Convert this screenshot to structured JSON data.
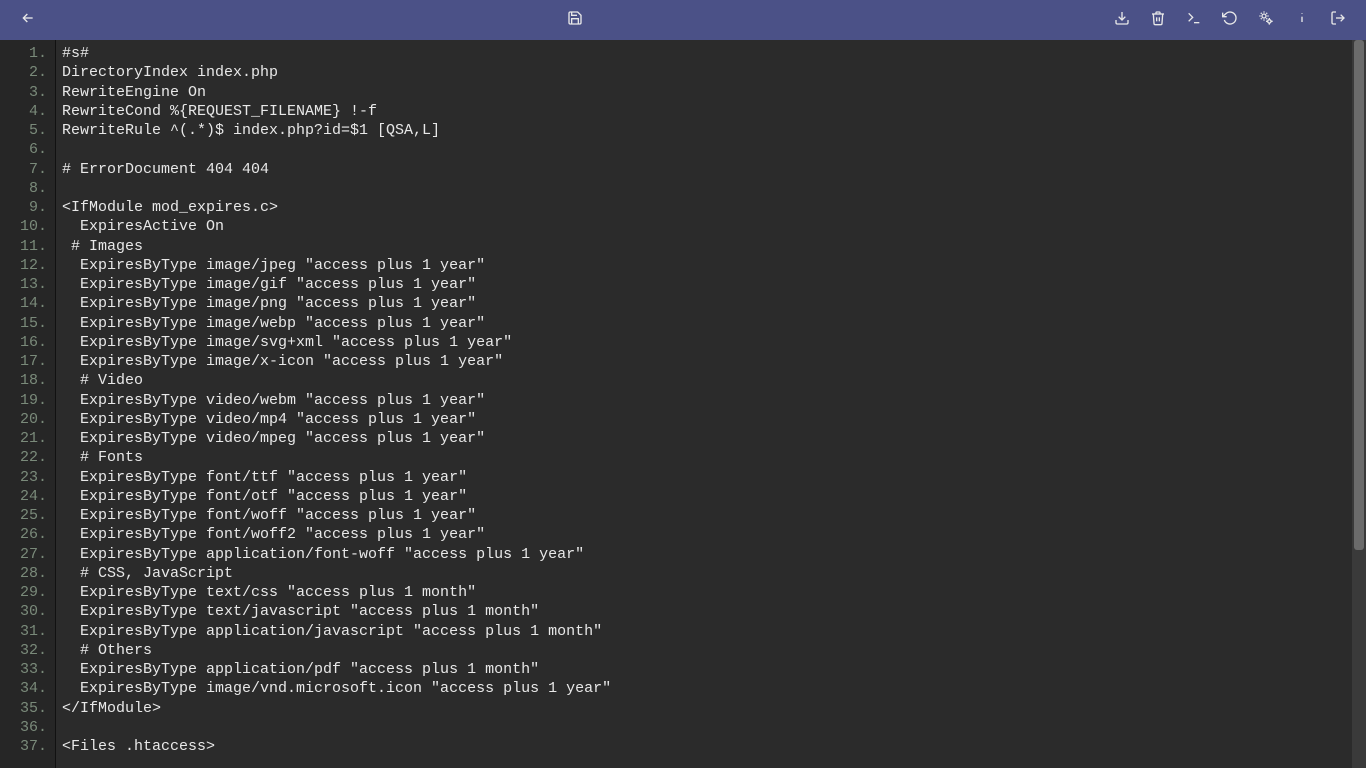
{
  "toolbar": {
    "back_title": "Back",
    "save_title": "Save",
    "download_title": "Download",
    "delete_title": "Delete",
    "console_title": "Terminal",
    "reload_title": "Reload",
    "settings_title": "Settings",
    "info_title": "Info",
    "logout_title": "Logout"
  },
  "code": {
    "lines": [
      "#s#",
      "DirectoryIndex index.php",
      "RewriteEngine On",
      "RewriteCond %{REQUEST_FILENAME} !-f",
      "RewriteRule ^(.*)$ index.php?id=$1 [QSA,L]",
      "",
      "# ErrorDocument 404 404",
      "",
      "<IfModule mod_expires.c>",
      "  ExpiresActive On",
      " # Images",
      "  ExpiresByType image/jpeg \"access plus 1 year\"",
      "  ExpiresByType image/gif \"access plus 1 year\"",
      "  ExpiresByType image/png \"access plus 1 year\"",
      "  ExpiresByType image/webp \"access plus 1 year\"",
      "  ExpiresByType image/svg+xml \"access plus 1 year\"",
      "  ExpiresByType image/x-icon \"access plus 1 year\"",
      "  # Video",
      "  ExpiresByType video/webm \"access plus 1 year\"",
      "  ExpiresByType video/mp4 \"access plus 1 year\"",
      "  ExpiresByType video/mpeg \"access plus 1 year\"",
      "  # Fonts",
      "  ExpiresByType font/ttf \"access plus 1 year\"",
      "  ExpiresByType font/otf \"access plus 1 year\"",
      "  ExpiresByType font/woff \"access plus 1 year\"",
      "  ExpiresByType font/woff2 \"access plus 1 year\"",
      "  ExpiresByType application/font-woff \"access plus 1 year\"",
      "  # CSS, JavaScript",
      "  ExpiresByType text/css \"access plus 1 month\"",
      "  ExpiresByType text/javascript \"access plus 1 month\"",
      "  ExpiresByType application/javascript \"access plus 1 month\"",
      "  # Others",
      "  ExpiresByType application/pdf \"access plus 1 month\"",
      "  ExpiresByType image/vnd.microsoft.icon \"access plus 1 year\"",
      "</IfModule>",
      "",
      "<Files .htaccess>"
    ]
  }
}
